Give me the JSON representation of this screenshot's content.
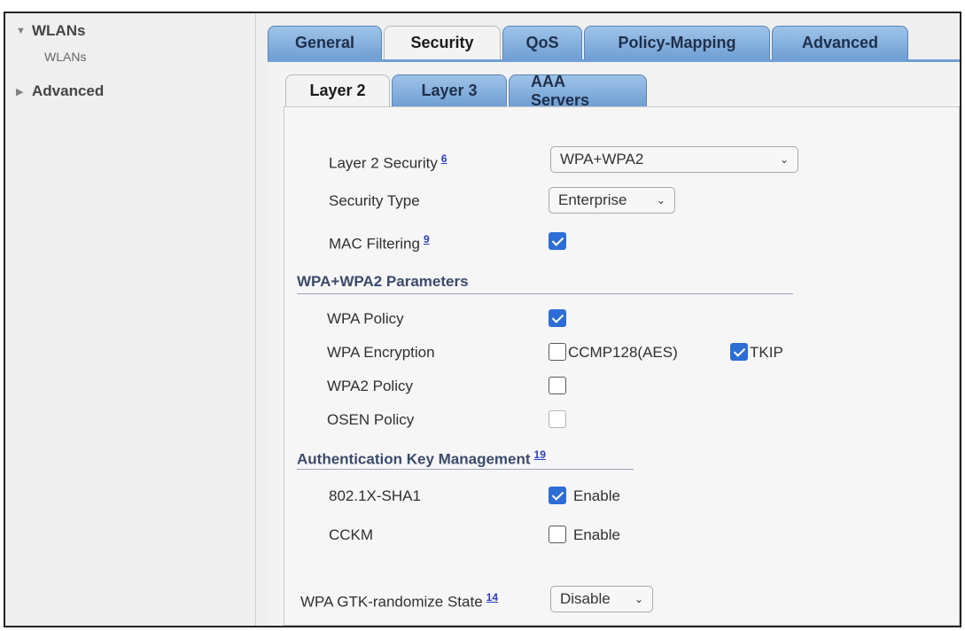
{
  "sidebar": {
    "wlans": {
      "label": "WLANs",
      "sub": "WLANs"
    },
    "advanced": {
      "label": "Advanced"
    }
  },
  "tabs": [
    "General",
    "Security",
    "QoS",
    "Policy-Mapping",
    "Advanced"
  ],
  "active_tab": "Security",
  "subtabs": [
    "Layer 2",
    "Layer 3",
    "AAA Servers"
  ],
  "active_subtab": "Layer 2",
  "form": {
    "layer2_security": {
      "label": "Layer 2 Security",
      "ref": "6",
      "value": "WPA+WPA2"
    },
    "security_type": {
      "label": "Security Type",
      "value": "Enterprise"
    },
    "mac_filtering": {
      "label": "MAC Filtering",
      "ref": "9",
      "checked": true
    },
    "wpa_section": {
      "title": "WPA+WPA2 Parameters"
    },
    "wpa_policy": {
      "label": "WPA Policy",
      "checked": true
    },
    "wpa_encryption": {
      "label": "WPA Encryption",
      "ccmp_label": "CCMP128(AES)",
      "ccmp_checked": false,
      "tkip_label": "TKIP",
      "tkip_checked": true
    },
    "wpa2_policy": {
      "label": "WPA2 Policy",
      "checked": false
    },
    "osen_policy": {
      "label": "OSEN Policy",
      "checked": false
    },
    "akm_section": {
      "title": "Authentication Key Management",
      "ref": "19"
    },
    "dot1x_sha1": {
      "label": "802.1X-SHA1",
      "enable_label": "Enable",
      "checked": true
    },
    "cckm": {
      "label": "CCKM",
      "enable_label": "Enable",
      "checked": false
    },
    "gtk_randomize": {
      "label": "WPA GTK-randomize State",
      "ref": "14",
      "value": "Disable"
    }
  },
  "colors": {
    "tab_blue": "#6f9fd4",
    "check_blue": "#2d6ed6",
    "section_title": "#3b4a6b"
  }
}
